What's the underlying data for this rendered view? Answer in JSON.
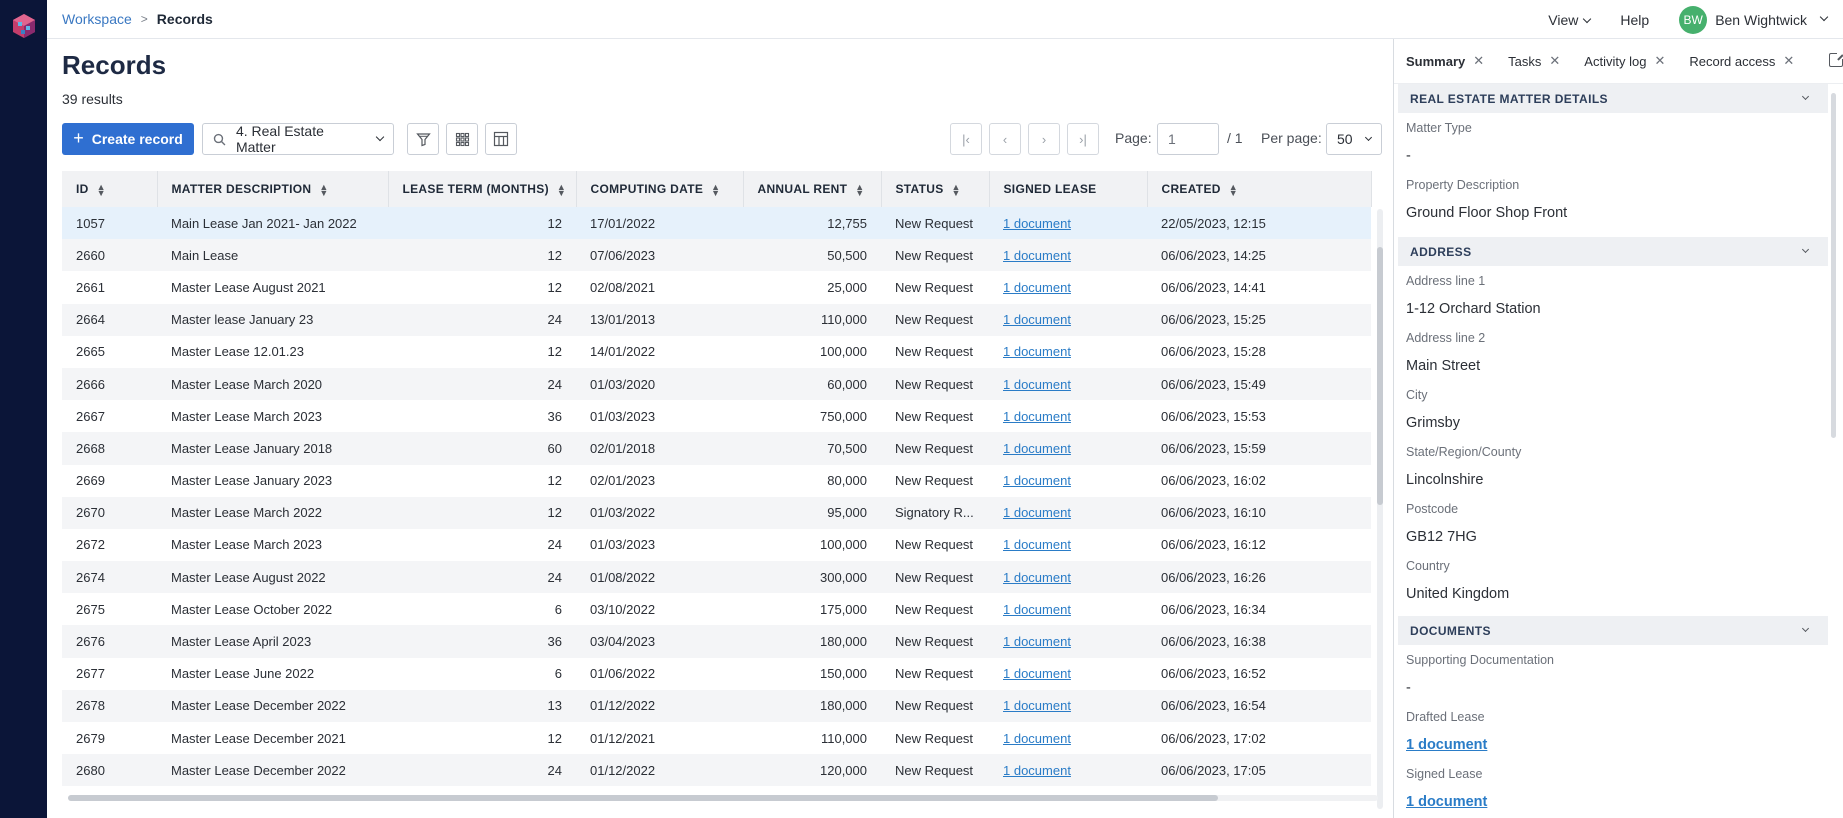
{
  "breadcrumb": {
    "parent": "Workspace",
    "separator": ">",
    "current": "Records"
  },
  "topbar": {
    "view": "View",
    "help": "Help",
    "user_initials": "BW",
    "user_name": "Ben Wightwick"
  },
  "page": {
    "title": "Records",
    "results": "39 results"
  },
  "toolbar": {
    "create_label": "Create record",
    "matter_select": "4. Real Estate Matter",
    "page_label": "Page:",
    "page_value": "1",
    "page_total": "/ 1",
    "per_page_label": "Per page:",
    "per_page_value": "50"
  },
  "table": {
    "columns": [
      "ID",
      "MATTER DESCRIPTION",
      "LEASE TERM (MONTHS)",
      "COMPUTING DATE",
      "ANNUAL RENT",
      "STATUS",
      "SIGNED LEASE",
      "CREATED"
    ],
    "rows": [
      [
        "1057",
        "Main Lease Jan 2021- Jan 2022",
        "12",
        "17/01/2022",
        "12,755",
        "New Request",
        "1 document",
        "22/05/2023, 12:15"
      ],
      [
        "2660",
        "Main Lease",
        "12",
        "07/06/2023",
        "50,500",
        "New Request",
        "1 document",
        "06/06/2023, 14:25"
      ],
      [
        "2661",
        "Master Lease August 2021",
        "12",
        "02/08/2021",
        "25,000",
        "New Request",
        "1 document",
        "06/06/2023, 14:41"
      ],
      [
        "2664",
        "Master lease January 23",
        "24",
        "13/01/2013",
        "110,000",
        "New Request",
        "1 document",
        "06/06/2023, 15:25"
      ],
      [
        "2665",
        "Master Lease 12.01.23",
        "12",
        "14/01/2022",
        "100,000",
        "New Request",
        "1 document",
        "06/06/2023, 15:28"
      ],
      [
        "2666",
        "Master Lease March 2020",
        "24",
        "01/03/2020",
        "60,000",
        "New Request",
        "1 document",
        "06/06/2023, 15:49"
      ],
      [
        "2667",
        "Master Lease March 2023",
        "36",
        "01/03/2023",
        "750,000",
        "New Request",
        "1 document",
        "06/06/2023, 15:53"
      ],
      [
        "2668",
        "Master Lease January 2018",
        "60",
        "02/01/2018",
        "70,500",
        "New Request",
        "1 document",
        "06/06/2023, 15:59"
      ],
      [
        "2669",
        "Master Lease January 2023",
        "12",
        "02/01/2023",
        "80,000",
        "New Request",
        "1 document",
        "06/06/2023, 16:02"
      ],
      [
        "2670",
        "Master Lease March 2022",
        "12",
        "01/03/2022",
        "95,000",
        "Signatory R...",
        "1 document",
        "06/06/2023, 16:10"
      ],
      [
        "2672",
        "Master Lease March 2023",
        "24",
        "01/03/2023",
        "100,000",
        "New Request",
        "1 document",
        "06/06/2023, 16:12"
      ],
      [
        "2674",
        "Master Lease August 2022",
        "24",
        "01/08/2022",
        "300,000",
        "New Request",
        "1 document",
        "06/06/2023, 16:26"
      ],
      [
        "2675",
        "Master Lease October 2022",
        "6",
        "03/10/2022",
        "175,000",
        "New Request",
        "1 document",
        "06/06/2023, 16:34"
      ],
      [
        "2676",
        "Master Lease April 2023",
        "36",
        "03/04/2023",
        "180,000",
        "New Request",
        "1 document",
        "06/06/2023, 16:38"
      ],
      [
        "2677",
        "Master Lease June 2022",
        "6",
        "01/06/2022",
        "150,000",
        "New Request",
        "1 document",
        "06/06/2023, 16:52"
      ],
      [
        "2678",
        "Master Lease December 2022",
        "13",
        "01/12/2022",
        "180,000",
        "New Request",
        "1 document",
        "06/06/2023, 16:54"
      ],
      [
        "2679",
        "Master Lease December 2021",
        "12",
        "01/12/2021",
        "110,000",
        "New Request",
        "1 document",
        "06/06/2023, 17:02"
      ],
      [
        "2680",
        "Master Lease December 2022",
        "24",
        "01/12/2022",
        "120,000",
        "New Request",
        "1 document",
        "06/06/2023, 17:05"
      ]
    ]
  },
  "panel": {
    "tabs": [
      "Summary",
      "Tasks",
      "Activity log",
      "Record access"
    ],
    "sections": [
      {
        "title": "REAL ESTATE MATTER DETAILS",
        "fields": [
          {
            "label": "Matter Type",
            "value": "-"
          },
          {
            "label": "Property Description",
            "value": "Ground Floor Shop Front"
          }
        ]
      },
      {
        "title": "ADDRESS",
        "fields": [
          {
            "label": "Address line 1",
            "value": "1-12 Orchard Station"
          },
          {
            "label": "Address line 2",
            "value": "Main Street"
          },
          {
            "label": "City",
            "value": "Grimsby"
          },
          {
            "label": "State/Region/County",
            "value": "Lincolnshire"
          },
          {
            "label": "Postcode",
            "value": "GB12 7HG"
          },
          {
            "label": "Country",
            "value": "United Kingdom"
          }
        ]
      },
      {
        "title": "DOCUMENTS",
        "fields": [
          {
            "label": "Supporting Documentation",
            "value": "-"
          },
          {
            "label": "Drafted Lease",
            "value": "1 document",
            "link": true
          },
          {
            "label": "Signed Lease",
            "value": "1 document",
            "link": true
          }
        ]
      }
    ]
  },
  "colors": {
    "rail": "#0b1538",
    "primary": "#2f6fd1",
    "link": "#2a7cc7",
    "selected_row": "#e6f1fb",
    "avatar": "#46b06d"
  }
}
